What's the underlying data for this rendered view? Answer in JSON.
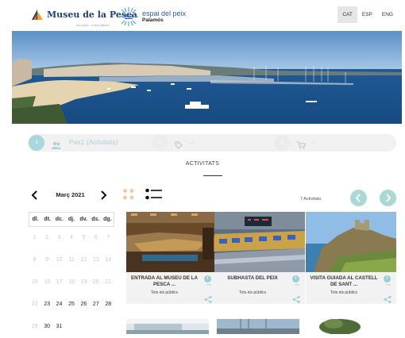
{
  "header": {
    "logo1_name": "Museu de la Pesca",
    "logo1_sub": "PALAMÓS · COSTA BRAVA",
    "logo2_line1": "espai del peix",
    "logo2_line2": "Palamós",
    "languages": [
      "CAT",
      "ESP",
      "ENG"
    ],
    "active_language": "CAT"
  },
  "steps": {
    "step1_num": "1",
    "step1_label": "Pas1 (Activitats)",
    "step2_num": "2",
    "step2_label": "...",
    "step3_num": "3",
    "step3_label": "..."
  },
  "section_title": "ACTIVITATS",
  "calendar": {
    "month": "Març 2021",
    "weekdays": [
      "dl.",
      "dt.",
      "dc.",
      "dj.",
      "dv.",
      "ds.",
      "dg."
    ],
    "weeks": [
      [
        "1",
        "2",
        "3",
        "4",
        "5",
        "6",
        "7"
      ],
      [
        "8",
        "9",
        "10",
        "11",
        "12",
        "13",
        "14"
      ],
      [
        "15",
        "16",
        "17",
        "18",
        "19",
        "20",
        "21"
      ],
      [
        "22",
        "23",
        "24",
        "25",
        "26",
        "27",
        "28"
      ],
      [
        "29",
        "30",
        "31",
        "",
        "",
        "",
        ""
      ]
    ]
  },
  "activity_count": "7 Activitats",
  "cards": [
    {
      "title": "ENTRADA AL MUSEU DE LA PESCA ...",
      "audience": "Tots els públics",
      "info": "Info"
    },
    {
      "title": "SUBHASTA DEL PEIX",
      "audience": "Tots els públics",
      "info": "Info"
    },
    {
      "title": "VISITA GUIADA AL CASTELL DE SANT ...",
      "audience": "Tots els públics",
      "info": "Info"
    }
  ],
  "colors": {
    "accent": "#a9d8d5",
    "brand_blue": "#1e3f78",
    "grid_icon": "#f5c8a3"
  }
}
